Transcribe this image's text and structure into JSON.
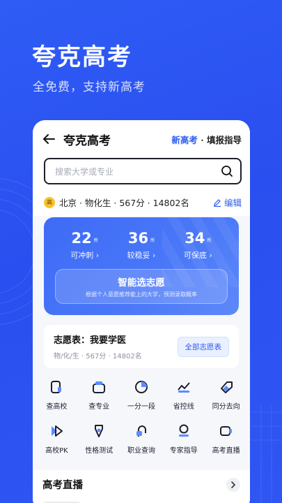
{
  "hero": {
    "title": "夸克高考",
    "subtitle": "全免费，支持新高考"
  },
  "topbar": {
    "back_icon": "back-arrow-icon",
    "title": "夸克高考",
    "right_brand": "新高考",
    "right_dot": "·",
    "right_text": "填报指导"
  },
  "search": {
    "placeholder": "搜索大学或专业",
    "icon": "search-icon"
  },
  "profile": {
    "badge_text": "高",
    "summary": "北京 · 物化生 · 567分 · 14802名",
    "edit_label": "编辑"
  },
  "score_card": {
    "stats": [
      {
        "value": "22",
        "unit": "所",
        "label": "可冲刺 ›"
      },
      {
        "value": "36",
        "unit": "所",
        "label": "较稳妥 ›"
      },
      {
        "value": "34",
        "unit": "所",
        "label": "可保底 ›"
      }
    ],
    "smart_title": "智能选志愿",
    "smart_sub": "根据个人意愿推荐能上的大学，预测录取概率"
  },
  "wish": {
    "title": "志愿表：我要学医",
    "sub": "物/化/生 · 567分 · 14802名",
    "all_label": "全部志愿表"
  },
  "grid": [
    {
      "label": "查高校",
      "icon": "school-icon"
    },
    {
      "label": "查专业",
      "icon": "major-icon"
    },
    {
      "label": "一分一段",
      "icon": "score-section-icon"
    },
    {
      "label": "省控线",
      "icon": "line-chart-icon"
    },
    {
      "label": "同分去向",
      "icon": "tag-icon"
    },
    {
      "label": "高校PK",
      "icon": "pk-icon"
    },
    {
      "label": "性格测试",
      "icon": "personality-test-icon"
    },
    {
      "label": "职业查询",
      "icon": "career-icon"
    },
    {
      "label": "专家指导",
      "icon": "expert-icon"
    },
    {
      "label": "高考直播",
      "icon": "live-video-icon"
    }
  ],
  "live": {
    "title": "高考直播",
    "more_icon": "chevron-right-icon"
  },
  "colors": {
    "background": "#2f5cf5",
    "accent": "#2d5bf0",
    "card_gradient_start": "#3e6bf6",
    "badge": "#f6c22c"
  }
}
